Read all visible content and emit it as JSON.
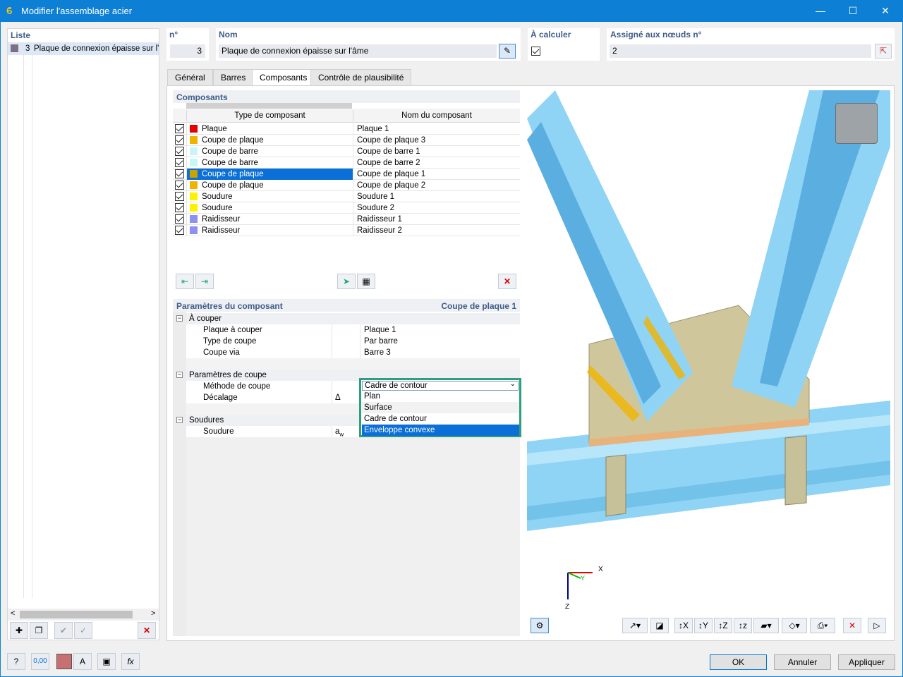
{
  "window": {
    "title": "Modifier l'assemblage acier",
    "minimize": "—",
    "maximize": "☐",
    "close": "✕"
  },
  "list": {
    "header": "Liste",
    "items": [
      {
        "num": "3",
        "label": "Plaque de connexion épaisse sur l'"
      }
    ]
  },
  "fields": {
    "num_label": "n°",
    "num_value": "3",
    "name_label": "Nom",
    "name_value": "Plaque de connexion épaisse sur l'âme",
    "calc_label": "À calculer",
    "nodes_label": "Assigné aux nœuds n°",
    "nodes_value": "2"
  },
  "tabs": [
    "Général",
    "Barres",
    "Composants",
    "Contrôle de plausibilité"
  ],
  "components": {
    "header": "Composants",
    "col_type": "Type de composant",
    "col_name": "Nom du composant",
    "rows": [
      {
        "type": "Plaque",
        "name": "Plaque 1",
        "color": "#e60000"
      },
      {
        "type": "Coupe de plaque",
        "name": "Coupe de plaque 3",
        "color": "#f0b400"
      },
      {
        "type": "Coupe de barre",
        "name": "Coupe de barre 1",
        "color": "#c8f5f8"
      },
      {
        "type": "Coupe de barre",
        "name": "Coupe de barre 2",
        "color": "#c8f5f8"
      },
      {
        "type": "Coupe de plaque",
        "name": "Coupe de plaque 1",
        "color": "#c9a400"
      },
      {
        "type": "Coupe de plaque",
        "name": "Coupe de plaque 2",
        "color": "#f0b400"
      },
      {
        "type": "Soudure",
        "name": "Soudure 1",
        "color": "#fff000"
      },
      {
        "type": "Soudure",
        "name": "Soudure 2",
        "color": "#fff000"
      },
      {
        "type": "Raidisseur",
        "name": "Raidisseur 1",
        "color": "#8f8ff0"
      },
      {
        "type": "Raidisseur",
        "name": "Raidisseur 2",
        "color": "#8f8ff0"
      }
    ]
  },
  "params": {
    "header": "Paramètres du composant",
    "current": "Coupe de plaque 1",
    "group1": "À couper",
    "plate_label": "Plaque à couper",
    "plate_value": "Plaque 1",
    "cuttype_label": "Type de coupe",
    "cuttype_value": "Par barre",
    "via_label": "Coupe via",
    "via_value": "Barre 3",
    "group2": "Paramètres de coupe",
    "method_label": "Méthode de coupe",
    "method_value": "Cadre de contour",
    "offset_label": "Décalage",
    "offset_sym": "Δ",
    "options": [
      "Plan",
      "Surface",
      "Cadre de contour",
      "Enveloppe convexe"
    ],
    "group3": "Soudures",
    "weld_label": "Soudure",
    "weld_sym": "a",
    "weld_sub": "w"
  },
  "axes": {
    "x": "X",
    "y": "Y",
    "z": "Z"
  },
  "buttons": {
    "ok": "OK",
    "cancel": "Annuler",
    "apply": "Appliquer"
  },
  "colors": {
    "accent": "#0d7fd5",
    "selection": "#0a6fd6",
    "header_text": "#3d5d8a",
    "focus": "#2e9e7d"
  }
}
